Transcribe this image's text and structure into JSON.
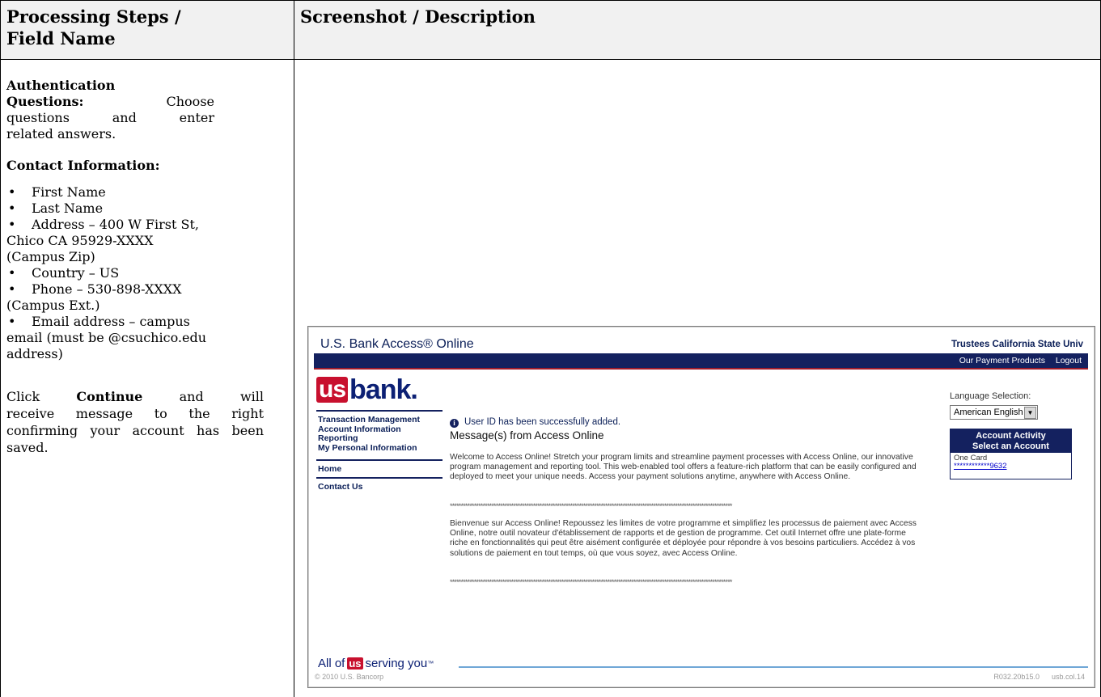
{
  "table": {
    "headers": [
      "Processing Steps / Field Name",
      "Screenshot / Description"
    ],
    "header_left_line1": "Processing Steps /",
    "header_left_line2": "Field Name",
    "header_right": "Screenshot / Description"
  },
  "left": {
    "auth_label": "Authentication Questions:",
    "auth_text": "Choose questions and enter related answers.",
    "contact_label": "Contact Information:",
    "contact_items": [
      "First Name",
      "Last Name",
      "Address – 400 W First St, Chico CA 95929-XXXX (Campus Zip)",
      "Country – US",
      "Phone – 530-898-XXXX (Campus Ext.)",
      "Email address – campus email (must be @csuchico.edu address)"
    ],
    "click_prefix": "Click",
    "continue_word": "Continue",
    "click_suffix": "and will receive message to the right confirming your account has been saved."
  },
  "screenshot": {
    "app_title": "U.S. Bank Access® Online",
    "org_name": "Trustees California State Univ",
    "top_links": [
      "Our Payment Products",
      "Logout"
    ],
    "logo_us": "us",
    "logo_bank": "bank.",
    "nav_group": [
      "Transaction Management",
      "Account Information",
      "Reporting",
      "My Personal Information"
    ],
    "nav_items": [
      "Home",
      "Contact Us"
    ],
    "info_message": "User ID has been successfully added.",
    "messages_title": "Message(s) from Access Online",
    "para_en": "Welcome to Access Online! Stretch your program limits and streamline payment processes with Access Online, our innovative program management and reporting tool. This web-enabled tool offers a feature-rich platform that can be easily configured and deployed to meet your unique needs. Access your payment solutions anytime, anywhere with Access Online.",
    "para_fr": "Bienvenue sur Access Online! Repoussez les limites de votre programme et simplifiez les processus de paiement avec Access Online, notre outil novateur d'établissement de rapports et de gestion de programme. Cet outil Internet offre une plate-forme riche en fonctionnalités qui peut être aisément configurée et déployée pour répondre à vos besoins particuliers. Accédez à vos solutions de paiement en tout temps, où que vous soyez, avec Access Online.",
    "stars": "*********************************************************************************************************************************",
    "language_label": "Language Selection:",
    "language_value": "American English",
    "acct_header_1": "Account Activity",
    "acct_header_2": "Select an Account",
    "acct_name": "One Card",
    "acct_number": "************9632",
    "footer_slogan_1": "All of",
    "footer_slogan_us": "us",
    "footer_slogan_2": "serving you",
    "copyright": "© 2010 U.S. Bancorp",
    "build_code": "R032.20b15.0      usb.col.14"
  }
}
